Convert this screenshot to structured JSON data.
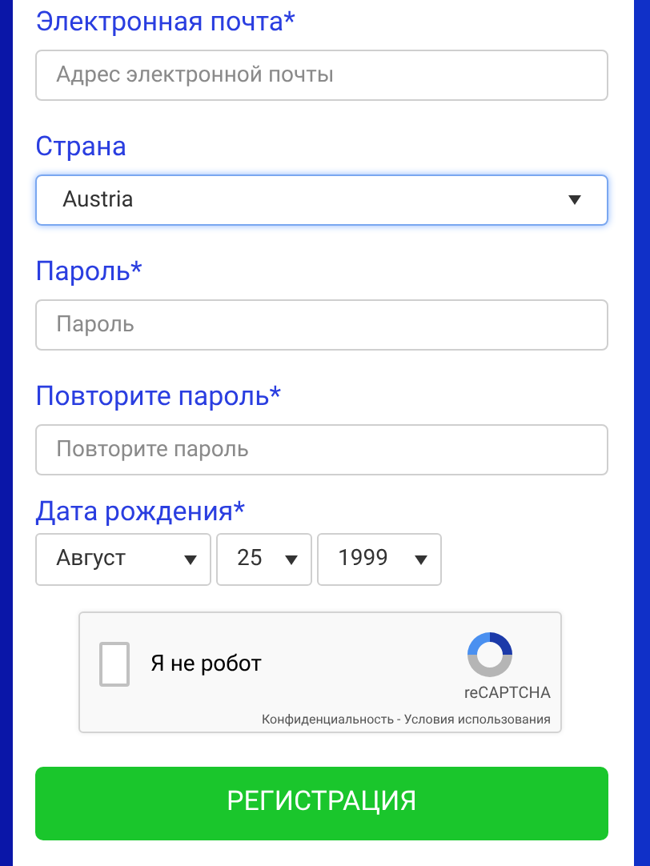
{
  "fields": [
    {
      "kind": "input",
      "label": "Электронная почта*",
      "placeholder": "Адрес электронной почты"
    },
    {
      "kind": "select",
      "label": "Страна",
      "value": "Austria",
      "focused": true
    },
    {
      "kind": "input",
      "label": "Пароль*",
      "placeholder": "Пароль"
    },
    {
      "kind": "input",
      "label": "Повторите пароль*",
      "placeholder": "Повторите пароль"
    }
  ],
  "birthdate": {
    "label": "Дата рождения*",
    "selects": [
      {
        "value": "Август"
      },
      {
        "value": "25"
      },
      {
        "value": "1999"
      }
    ]
  },
  "captcha": {
    "label": "Я не робот",
    "checked": false,
    "brand": "reCAPTCHA",
    "links": "Конфиденциальность - Условия использования"
  },
  "submit": {
    "label": "РЕГИСТРАЦИЯ"
  }
}
